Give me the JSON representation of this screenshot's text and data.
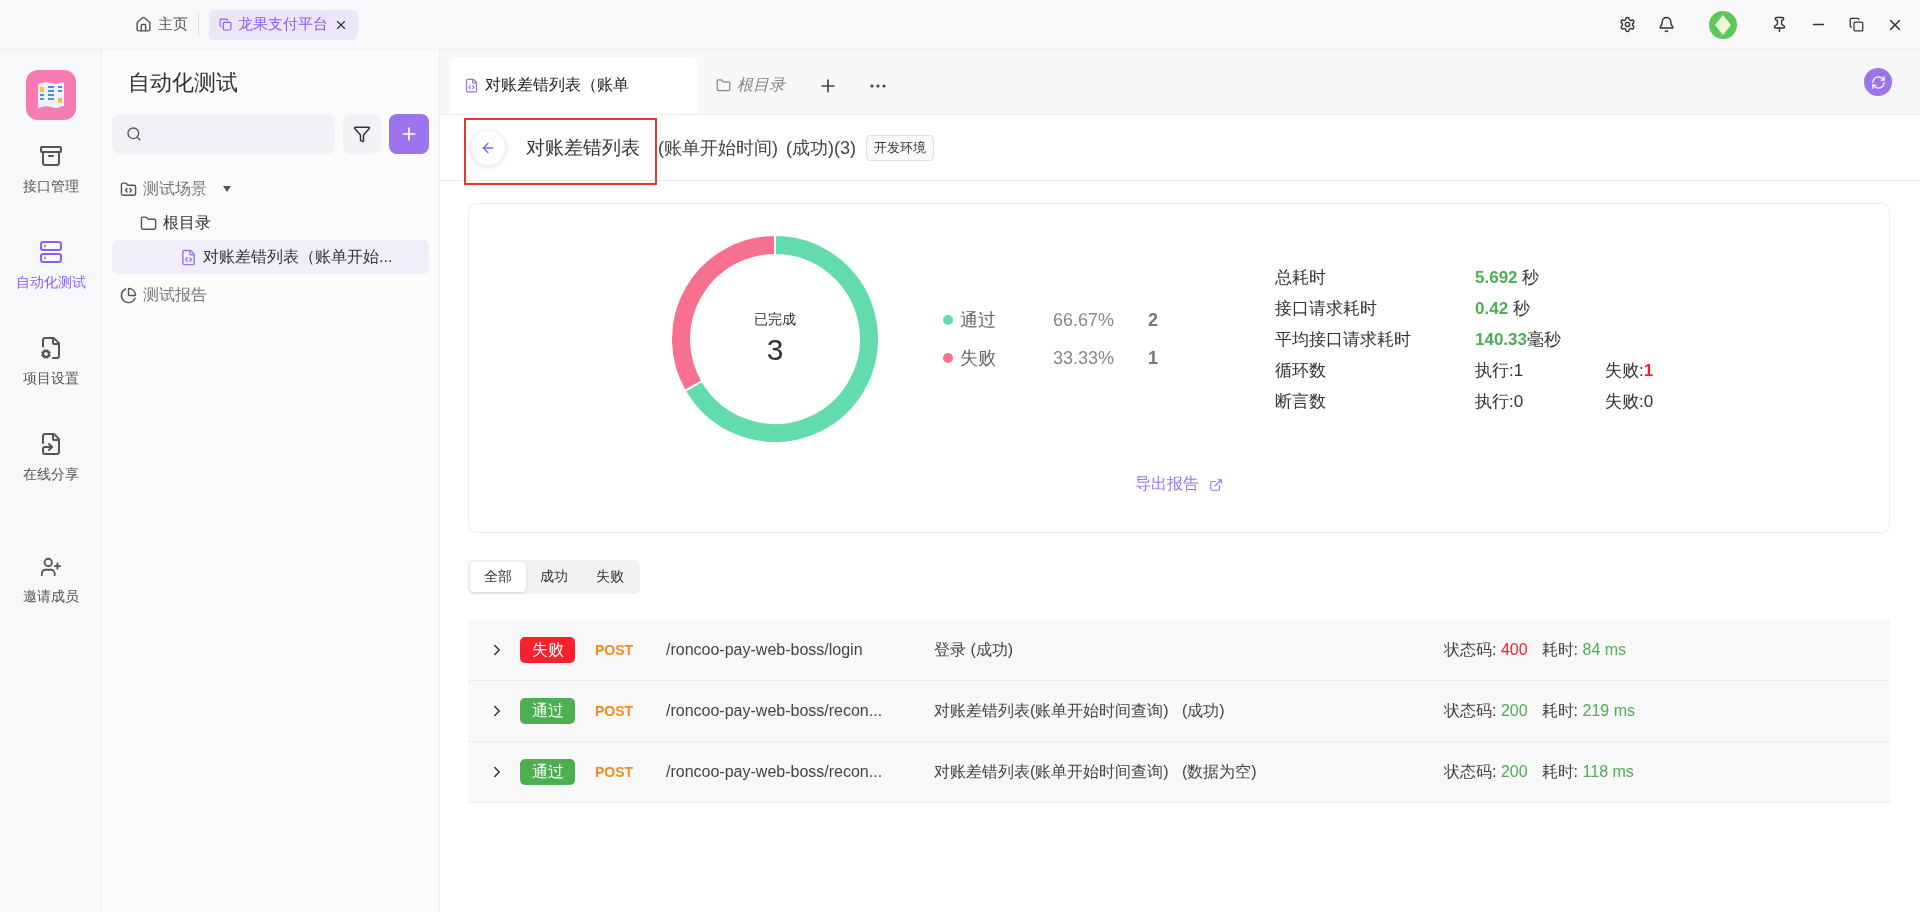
{
  "titlebar": {
    "home": "主页",
    "tabs": [
      {
        "label": "龙果支付平台",
        "selected": true
      }
    ]
  },
  "rail": {
    "items": [
      {
        "label": "接口管理",
        "selected": false
      },
      {
        "label": "自动化测试",
        "selected": true
      },
      {
        "label": "项目设置",
        "selected": false
      },
      {
        "label": "在线分享",
        "selected": false
      }
    ],
    "invite": "邀请成员"
  },
  "sidebar": {
    "title": "自动化测试",
    "tree": [
      {
        "label": "测试场景",
        "kind": "scenario",
        "expanded": true,
        "children": [
          {
            "label": "根目录",
            "kind": "folder",
            "children": [
              {
                "label": "对账差错列表（账单开始...",
                "kind": "case",
                "selected": true
              }
            ]
          }
        ]
      },
      {
        "label": "测试报告",
        "kind": "report"
      }
    ]
  },
  "doc_tabs": [
    {
      "label": "对账差错列表（账单",
      "kind": "case",
      "selected": true
    },
    {
      "label": "根目录",
      "kind": "folder",
      "selected": false
    }
  ],
  "header": {
    "title": "对账差错列表",
    "subtitle": "(账单开始时间)",
    "status": "(成功)(3)",
    "env": "开发环境",
    "highlighted": true
  },
  "summary": {
    "chart_data": {
      "type": "donut",
      "categories": [
        "通过",
        "失败"
      ],
      "values": [
        66.67,
        33.33
      ]
    },
    "center_label": "已完成",
    "center_value": "3",
    "legend": [
      {
        "percent": "66.67%",
        "count": "2",
        "color": "#62dbad"
      },
      {
        "percent": "33.33%",
        "count": "1",
        "color": "#f7718f"
      }
    ],
    "stats": [
      {
        "label": "总耗时",
        "value": "5.692",
        "unit": "秒"
      },
      {
        "label": "接口请求耗时",
        "value": "0.42",
        "unit": "秒"
      },
      {
        "label": "平均接口请求耗时",
        "value": "140.33",
        "unit": "毫秒"
      },
      {
        "label": "循环数",
        "exec_label": "执行:",
        "exec": "1",
        "fail_label": "失败:",
        "fail": "1",
        "fail_alert": true
      },
      {
        "label": "断言数",
        "exec_label": "执行:",
        "exec": "0",
        "fail_label": "失败:",
        "fail": "0",
        "fail_alert": false
      }
    ],
    "export": "导出报告"
  },
  "filters": [
    {
      "label": "全部",
      "selected": true
    },
    {
      "label": "成功",
      "selected": false
    },
    {
      "label": "失败",
      "selected": false
    }
  ],
  "results": [
    {
      "badge": "失败",
      "passed": false,
      "method": "POST",
      "path": "/roncoo-pay-web-boss/login",
      "name": "登录 (成功)",
      "code_label": "状态码:",
      "code": "400",
      "code_ok": false,
      "time_label": "耗时:",
      "time": "84 ms"
    },
    {
      "badge": "通过",
      "passed": true,
      "method": "POST",
      "path": "/roncoo-pay-web-boss/recon...",
      "name": "对账差错列表(账单开始时间查询)   (成功)",
      "code_label": "状态码:",
      "code": "200",
      "code_ok": true,
      "time_label": "耗时:",
      "time": "219 ms"
    },
    {
      "badge": "通过",
      "passed": true,
      "method": "POST",
      "path": "/roncoo-pay-web-boss/recon...",
      "name": "对账差错列表(账单开始时间查询)   (数据为空)",
      "code_label": "状态码:",
      "code": "200",
      "code_ok": true,
      "time_label": "耗时:",
      "time": "118 ms"
    }
  ]
}
